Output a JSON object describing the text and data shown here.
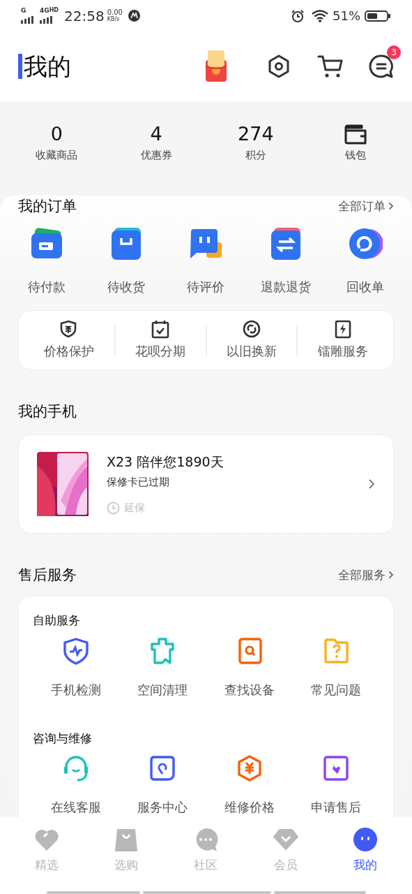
{
  "status_bar": {
    "signal_1": "G",
    "signal_2": "4G",
    "signal_2_sup": "HD",
    "time": "22:58",
    "net_speed": "0.00",
    "net_unit": "KB/s",
    "battery": "51%"
  },
  "header": {
    "title": "我的",
    "message_badge": "3"
  },
  "stats": [
    {
      "kind": "number",
      "value": "0",
      "label": "收藏商品"
    },
    {
      "kind": "number",
      "value": "4",
      "label": "优惠券"
    },
    {
      "kind": "number",
      "value": "274",
      "label": "积分"
    },
    {
      "kind": "icon",
      "label": "钱包"
    }
  ],
  "orders": {
    "title": "我的订单",
    "more": "全部订单",
    "items": [
      "待付款",
      "待收货",
      "待评价",
      "退款退货",
      "回收单"
    ],
    "services": [
      "价格保护",
      "花呗分期",
      "以旧换新",
      "镭雕服务"
    ]
  },
  "my_phone": {
    "title": "我的手机",
    "name": "X23 陪伴您1890天",
    "warranty": "保修卡已过期",
    "extend": "延保"
  },
  "after_sales": {
    "title": "售后服务",
    "more": "全部服务",
    "groups": [
      {
        "title": "自助服务",
        "items": [
          "手机检测",
          "空间清理",
          "查找设备",
          "常见问题"
        ]
      },
      {
        "title": "咨询与维修",
        "items": [
          "在线客服",
          "服务中心",
          "维修价格",
          "申请售后"
        ]
      }
    ]
  },
  "tab_bar": [
    {
      "label": "精选",
      "selected": false
    },
    {
      "label": "选购",
      "selected": false
    },
    {
      "label": "社区",
      "selected": false
    },
    {
      "label": "会员",
      "selected": false
    },
    {
      "label": "我的",
      "selected": true
    }
  ]
}
